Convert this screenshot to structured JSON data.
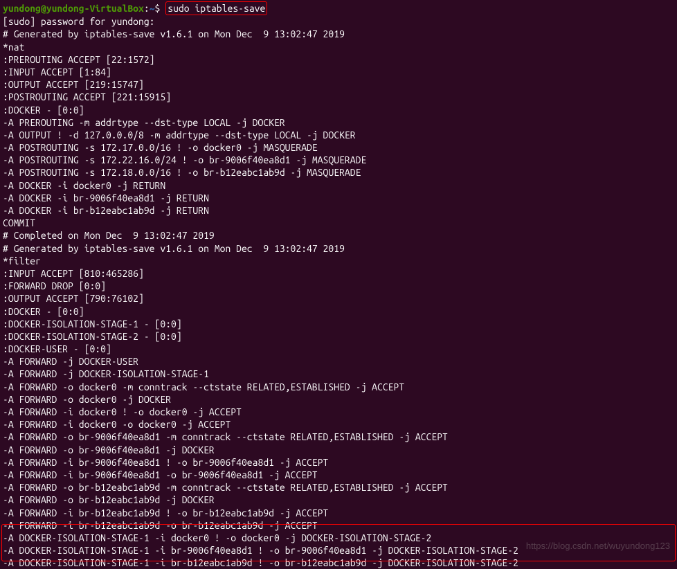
{
  "prompt": {
    "user": "yundong",
    "at": "@",
    "host": "yundong-VirtualBox",
    "colon": ":",
    "path": "~",
    "dollar": "$",
    "command": "sudo iptables-save"
  },
  "lines": [
    "[sudo] password for yundong:",
    "# Generated by iptables-save v1.6.1 on Mon Dec  9 13:02:47 2019",
    "*nat",
    ":PREROUTING ACCEPT [22:1572]",
    ":INPUT ACCEPT [1:84]",
    ":OUTPUT ACCEPT [219:15747]",
    ":POSTROUTING ACCEPT [221:15915]",
    ":DOCKER - [0:0]",
    "-A PREROUTING -m addrtype --dst-type LOCAL -j DOCKER",
    "-A OUTPUT ! -d 127.0.0.0/8 -m addrtype --dst-type LOCAL -j DOCKER",
    "-A POSTROUTING -s 172.17.0.0/16 ! -o docker0 -j MASQUERADE",
    "-A POSTROUTING -s 172.22.16.0/24 ! -o br-9006f40ea8d1 -j MASQUERADE",
    "-A POSTROUTING -s 172.18.0.0/16 ! -o br-b12eabc1ab9d -j MASQUERADE",
    "-A DOCKER -i docker0 -j RETURN",
    "-A DOCKER -i br-9006f40ea8d1 -j RETURN",
    "-A DOCKER -i br-b12eabc1ab9d -j RETURN",
    "COMMIT",
    "# Completed on Mon Dec  9 13:02:47 2019",
    "# Generated by iptables-save v1.6.1 on Mon Dec  9 13:02:47 2019",
    "*filter",
    ":INPUT ACCEPT [810:465286]",
    ":FORWARD DROP [0:0]",
    ":OUTPUT ACCEPT [790:76102]",
    ":DOCKER - [0:0]",
    ":DOCKER-ISOLATION-STAGE-1 - [0:0]",
    ":DOCKER-ISOLATION-STAGE-2 - [0:0]",
    ":DOCKER-USER - [0:0]",
    "-A FORWARD -j DOCKER-USER",
    "-A FORWARD -j DOCKER-ISOLATION-STAGE-1",
    "-A FORWARD -o docker0 -m conntrack --ctstate RELATED,ESTABLISHED -j ACCEPT",
    "-A FORWARD -o docker0 -j DOCKER",
    "-A FORWARD -i docker0 ! -o docker0 -j ACCEPT",
    "-A FORWARD -i docker0 -o docker0 -j ACCEPT",
    "-A FORWARD -o br-9006f40ea8d1 -m conntrack --ctstate RELATED,ESTABLISHED -j ACCEPT",
    "-A FORWARD -o br-9006f40ea8d1 -j DOCKER",
    "-A FORWARD -i br-9006f40ea8d1 ! -o br-9006f40ea8d1 -j ACCEPT",
    "-A FORWARD -i br-9006f40ea8d1 -o br-9006f40ea8d1 -j ACCEPT",
    "-A FORWARD -o br-b12eabc1ab9d -m conntrack --ctstate RELATED,ESTABLISHED -j ACCEPT",
    "-A FORWARD -o br-b12eabc1ab9d -j DOCKER",
    "-A FORWARD -i br-b12eabc1ab9d ! -o br-b12eabc1ab9d -j ACCEPT",
    "-A FORWARD -i br-b12eabc1ab9d -o br-b12eabc1ab9d -j ACCEPT",
    "-A DOCKER-ISOLATION-STAGE-1 -i docker0 ! -o docker0 -j DOCKER-ISOLATION-STAGE-2",
    "-A DOCKER-ISOLATION-STAGE-1 -i br-9006f40ea8d1 ! -o br-9006f40ea8d1 -j DOCKER-ISOLATION-STAGE-2",
    "-A DOCKER-ISOLATION-STAGE-1 -i br-b12eabc1ab9d ! -o br-b12eabc1ab9d -j DOCKER-ISOLATION-STAGE-2"
  ],
  "watermark": "https://blog.csdn.net/wuyundong123"
}
